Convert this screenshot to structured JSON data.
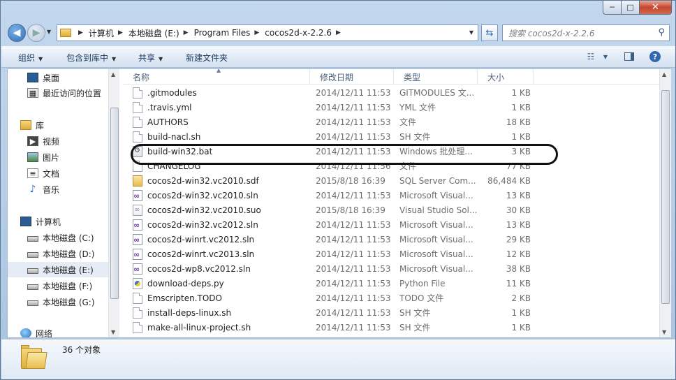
{
  "window": {
    "caption": {
      "minimize": "─",
      "maximize": "□",
      "close": "✕"
    }
  },
  "address": {
    "breadcrumbs": [
      "计算机",
      "本地磁盘 (E:)",
      "Program Files",
      "cocos2d-x-2.2.6"
    ],
    "search_placeholder": "搜索 cocos2d-x-2.2.6"
  },
  "toolbar": {
    "organize": "组织",
    "include_in_library": "包含到库中",
    "share": "共享",
    "new_folder": "新建文件夹"
  },
  "nav": {
    "items": [
      {
        "label": "桌面",
        "icon": "desktop-icon"
      },
      {
        "label": "最近访问的位置",
        "icon": "recent-places-icon"
      },
      {
        "label": "库",
        "icon": "library-icon"
      },
      {
        "label": "视频",
        "icon": "video-library-icon"
      },
      {
        "label": "图片",
        "icon": "pictures-library-icon"
      },
      {
        "label": "文档",
        "icon": "documents-library-icon"
      },
      {
        "label": "音乐",
        "icon": "music-library-icon"
      },
      {
        "label": "计算机",
        "icon": "computer-icon"
      },
      {
        "label": "本地磁盘 (C:)",
        "icon": "drive-c-icon"
      },
      {
        "label": "本地磁盘 (D:)",
        "icon": "drive-icon"
      },
      {
        "label": "本地磁盘 (E:)",
        "icon": "drive-icon",
        "selected": true
      },
      {
        "label": "本地磁盘 (F:)",
        "icon": "drive-icon"
      },
      {
        "label": "本地磁盘 (G:)",
        "icon": "drive-icon"
      },
      {
        "label": "网络",
        "icon": "network-icon"
      }
    ]
  },
  "columns": {
    "name": "名称",
    "date": "修改日期",
    "type": "类型",
    "size": "大小"
  },
  "files": [
    {
      "name": ".gitmodules",
      "date": "2014/12/11 11:53",
      "type": "GITMODULES 文...",
      "size": "1 KB",
      "icon": "doc"
    },
    {
      "name": ".travis.yml",
      "date": "2014/12/11 11:53",
      "type": "YML 文件",
      "size": "1 KB",
      "icon": "doc"
    },
    {
      "name": "AUTHORS",
      "date": "2014/12/11 11:53",
      "type": "文件",
      "size": "18 KB",
      "icon": "doc"
    },
    {
      "name": "build-nacl.sh",
      "date": "2014/12/11 11:53",
      "type": "SH 文件",
      "size": "1 KB",
      "icon": "doc"
    },
    {
      "name": "build-win32.bat",
      "date": "2014/12/11 11:53",
      "type": "Windows 批处理...",
      "size": "3 KB",
      "icon": "bat"
    },
    {
      "name": "CHANGELOG",
      "date": "2014/12/11 11:56",
      "type": "文件",
      "size": "77 KB",
      "icon": "doc"
    },
    {
      "name": "cocos2d-win32.vc2010.sdf",
      "date": "2015/8/18 16:39",
      "type": "SQL Server Com...",
      "size": "86,484 KB",
      "icon": "sdf"
    },
    {
      "name": "cocos2d-win32.vc2010.sln",
      "date": "2014/12/11 11:53",
      "type": "Microsoft Visual...",
      "size": "13 KB",
      "icon": "sln"
    },
    {
      "name": "cocos2d-win32.vc2010.suo",
      "date": "2015/8/18 16:39",
      "type": "Visual Studio Sol...",
      "size": "30 KB",
      "icon": "suo"
    },
    {
      "name": "cocos2d-win32.vc2012.sln",
      "date": "2014/12/11 11:53",
      "type": "Microsoft Visual...",
      "size": "13 KB",
      "icon": "sln"
    },
    {
      "name": "cocos2d-winrt.vc2012.sln",
      "date": "2014/12/11 11:53",
      "type": "Microsoft Visual...",
      "size": "29 KB",
      "icon": "sln"
    },
    {
      "name": "cocos2d-winrt.vc2013.sln",
      "date": "2014/12/11 11:53",
      "type": "Microsoft Visual...",
      "size": "12 KB",
      "icon": "sln"
    },
    {
      "name": "cocos2d-wp8.vc2012.sln",
      "date": "2014/12/11 11:53",
      "type": "Microsoft Visual...",
      "size": "38 KB",
      "icon": "sln"
    },
    {
      "name": "download-deps.py",
      "date": "2014/12/11 11:53",
      "type": "Python File",
      "size": "11 KB",
      "icon": "py"
    },
    {
      "name": "Emscripten.TODO",
      "date": "2014/12/11 11:53",
      "type": "TODO 文件",
      "size": "2 KB",
      "icon": "doc"
    },
    {
      "name": "install-deps-linux.sh",
      "date": "2014/12/11 11:53",
      "type": "SH 文件",
      "size": "1 KB",
      "icon": "doc"
    },
    {
      "name": "make-all-linux-project.sh",
      "date": "2014/12/11 11:53",
      "type": "SH 文件",
      "size": "1 KB",
      "icon": "doc"
    }
  ],
  "status": {
    "count": "36 个对象"
  }
}
